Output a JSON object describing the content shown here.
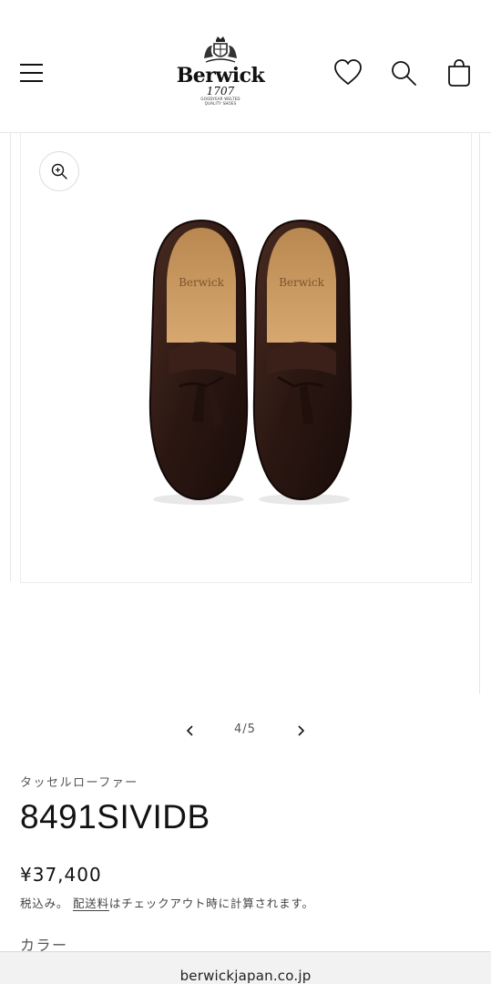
{
  "header": {
    "brand_name": "Berwick",
    "brand_year": "1707",
    "brand_tagline_1": "GOODYEAR WELTED",
    "brand_tagline_2": "QUALITY SHOES",
    "icons": [
      "menu-icon",
      "heart-icon",
      "search-icon",
      "cart-icon"
    ]
  },
  "gallery": {
    "current": 4,
    "total": 5,
    "counter_text": "4/5",
    "icons": [
      "zoom-icon",
      "chevron-left-icon",
      "chevron-right-icon"
    ]
  },
  "product": {
    "vendor": "タッセルローファー",
    "title": "8491SIVIDB",
    "price": "¥37,400",
    "tax_prefix": "税込み。",
    "shipping_link": "配送料",
    "tax_suffix": "はチェックアウト時に計算されます。",
    "color_label": "カラー"
  },
  "browser": {
    "url": "berwickjapan.co.jp"
  },
  "colors": {
    "text": "#121212",
    "muted": "#555555",
    "border": "#e6e6e6",
    "leather": "#2a1712",
    "insole": "#c99a62"
  }
}
